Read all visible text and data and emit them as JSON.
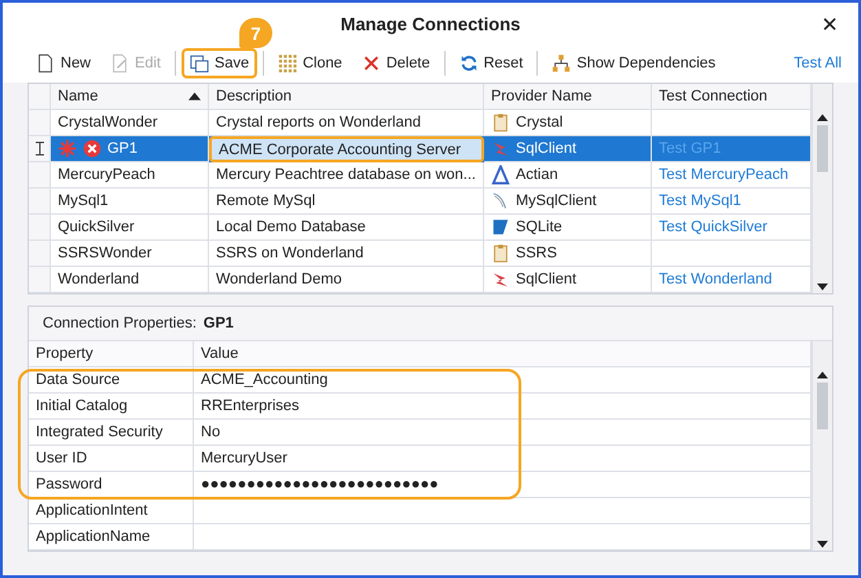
{
  "window": {
    "title": "Manage Connections",
    "close": "✕"
  },
  "toolbar": [
    {
      "kind": "new",
      "label": "New",
      "disabled": false,
      "highlighted": false
    },
    {
      "kind": "edit",
      "label": "Edit",
      "disabled": true,
      "highlighted": false
    },
    {
      "kind": "save",
      "label": "Save",
      "disabled": false,
      "highlighted": true,
      "callout": "7"
    },
    {
      "kind": "clone",
      "label": "Clone",
      "disabled": false,
      "highlighted": false
    },
    {
      "kind": "delete",
      "label": "Delete",
      "disabled": false,
      "highlighted": false
    },
    {
      "kind": "reset",
      "label": "Reset",
      "disabled": false,
      "highlighted": false
    },
    {
      "kind": "dependencies",
      "label": "Show Dependencies",
      "disabled": false,
      "highlighted": false
    }
  ],
  "test_all": "Test All",
  "connections": {
    "columns": [
      {
        "label": "Name",
        "sorted": true
      },
      {
        "label": "Description",
        "sorted": false
      },
      {
        "label": "Provider Name",
        "sorted": false
      },
      {
        "label": "Test Connection",
        "sorted": false
      }
    ],
    "rows": [
      {
        "name": "CrystalWonder",
        "description": "Crystal reports on Wonderland",
        "provider": "Crystal",
        "kind": "clipboard",
        "selected": false,
        "editing": false,
        "modified": false,
        "error": false
      },
      {
        "name": "GP1",
        "description": "ACME Corporate Accounting Server",
        "provider": "SqlClient",
        "kind": "sqlserver",
        "test": "Test GP1",
        "selected": true,
        "editing": true,
        "modified": true,
        "error": true
      },
      {
        "name": "MercuryPeach",
        "description": "Mercury Peachtree database on won...",
        "provider": "Actian",
        "kind": "actian",
        "test": "Test MercuryPeach",
        "selected": false,
        "editing": false,
        "modified": false,
        "error": false
      },
      {
        "name": "MySql1",
        "description": "Remote MySql",
        "provider": "MySqlClient",
        "kind": "mysql",
        "test": "Test MySql1",
        "selected": false,
        "editing": false,
        "modified": false,
        "error": false
      },
      {
        "name": "QuickSilver",
        "description": "Local Demo Database",
        "provider": "SQLite",
        "kind": "sqlite",
        "test": "Test QuickSilver",
        "selected": false,
        "editing": false,
        "modified": false,
        "error": false
      },
      {
        "name": "SSRSWonder",
        "description": "SSRS on Wonderland",
        "provider": "SSRS",
        "kind": "clipboard",
        "selected": false,
        "editing": false,
        "modified": false,
        "error": false
      },
      {
        "name": "Wonderland",
        "description": "Wonderland Demo",
        "provider": "SqlClient",
        "kind": "sqlserver",
        "test": "Test Wonderland",
        "selected": false,
        "editing": false,
        "modified": false,
        "error": false
      }
    ]
  },
  "properties": {
    "label": "Connection Properties:",
    "connection": "GP1",
    "columns": [
      "Property",
      "Value"
    ],
    "rows": [
      {
        "property": "Data Source",
        "value": "ACME_Accounting",
        "highlighted": true
      },
      {
        "property": "Initial Catalog",
        "value": "RREnterprises",
        "highlighted": true
      },
      {
        "property": "Integrated Security",
        "value": "No",
        "highlighted": true
      },
      {
        "property": "User ID",
        "value": "MercuryUser",
        "highlighted": true
      },
      {
        "property": "Password",
        "value": "●●●●●●●●●●●●●●●●●●●●●●●●●●",
        "highlighted": true
      },
      {
        "property": "ApplicationIntent",
        "highlighted": false
      },
      {
        "property": "ApplicationName",
        "highlighted": false
      }
    ]
  }
}
